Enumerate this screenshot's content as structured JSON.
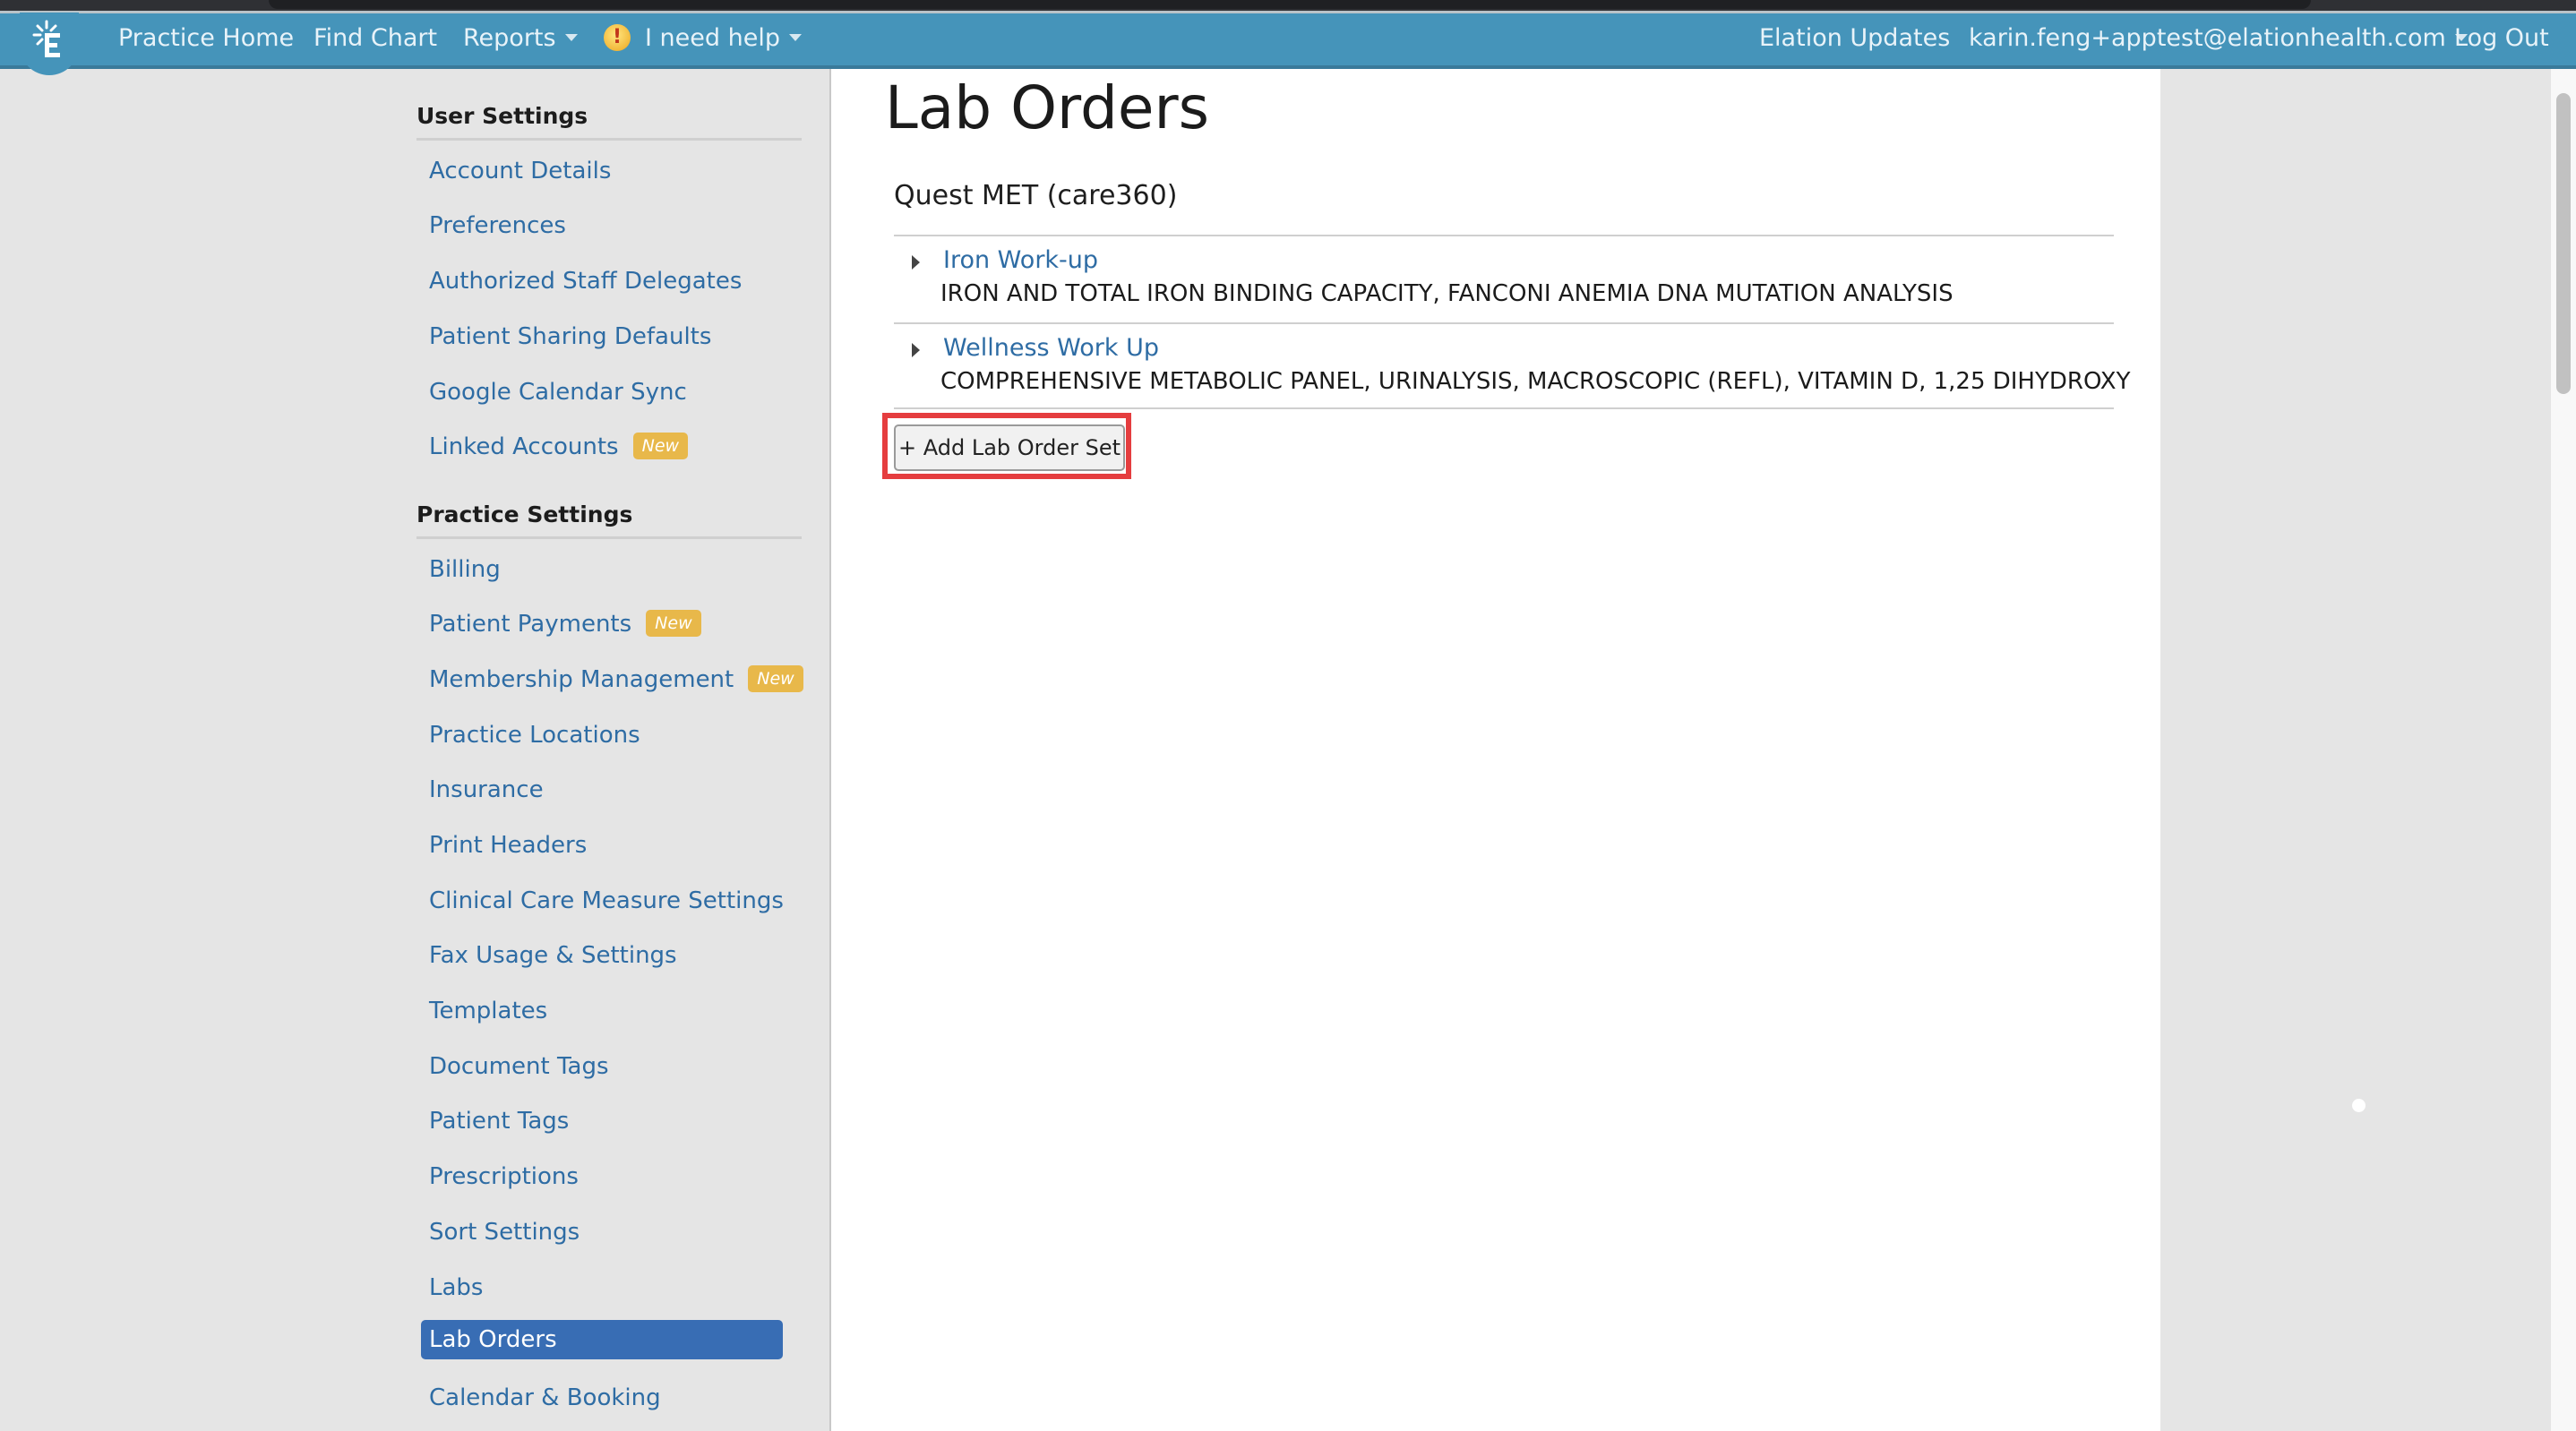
{
  "colors": {
    "navbar": "#4594ba",
    "link": "#2e6ca4",
    "active_item_bg": "#386db4",
    "badge_new": "#e8b84a",
    "highlight": "#e53d3f"
  },
  "navbar": {
    "logo_icon": "elation-logo-icon",
    "left_links": [
      {
        "label": "Practice Home"
      },
      {
        "label": "Find Chart"
      },
      {
        "label": "Reports",
        "has_dropdown": true
      }
    ],
    "help": {
      "icon": "warning-icon",
      "glyph": "!",
      "label": "I need help",
      "has_dropdown": true
    },
    "right_links": [
      {
        "label": "Elation Updates"
      },
      {
        "label": "karin.feng+apptest@elationhealth.com",
        "has_dropdown": true
      },
      {
        "label": "Log Out"
      }
    ]
  },
  "sidebar": {
    "sections": [
      {
        "heading": "User Settings",
        "items": [
          {
            "label": "Account Details"
          },
          {
            "label": "Preferences"
          },
          {
            "label": "Authorized Staff Delegates"
          },
          {
            "label": "Patient Sharing Defaults"
          },
          {
            "label": "Google Calendar Sync"
          },
          {
            "label": "Linked Accounts",
            "badge": "New"
          }
        ]
      },
      {
        "heading": "Practice Settings",
        "items": [
          {
            "label": "Billing"
          },
          {
            "label": "Patient Payments",
            "badge": "New"
          },
          {
            "label": "Membership Management",
            "badge": "New"
          },
          {
            "label": "Practice Locations"
          },
          {
            "label": "Insurance"
          },
          {
            "label": "Print Headers"
          },
          {
            "label": "Clinical Care Measure Settings"
          },
          {
            "label": "Fax Usage & Settings"
          },
          {
            "label": "Templates"
          },
          {
            "label": "Document Tags"
          },
          {
            "label": "Patient Tags"
          },
          {
            "label": "Prescriptions"
          },
          {
            "label": "Sort Settings"
          },
          {
            "label": "Labs"
          },
          {
            "label": "Lab Orders",
            "active": true
          },
          {
            "label": "Calendar & Booking"
          }
        ]
      }
    ]
  },
  "main": {
    "title": "Lab Orders",
    "lab_vendor": "Quest MET (care360)",
    "order_sets": [
      {
        "name": "Iron Work-up",
        "tests": "IRON AND TOTAL IRON BINDING CAPACITY, FANCONI ANEMIA DNA MUTATION ANALYSIS"
      },
      {
        "name": "Wellness Work Up",
        "tests": "COMPREHENSIVE METABOLIC PANEL, URINALYSIS, MACROSCOPIC (REFL), VITAMIN D, 1,25 DIHYDROXY"
      }
    ],
    "add_button_label": "+ Add Lab Order Set"
  }
}
